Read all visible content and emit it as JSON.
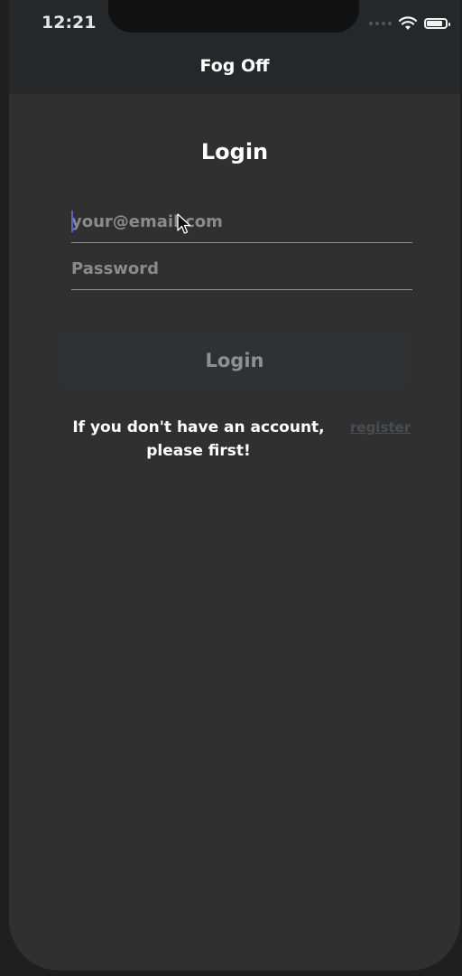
{
  "status_bar": {
    "time": "12:21",
    "battery_level": 0.85
  },
  "header": {
    "title": "Fog Off"
  },
  "form": {
    "heading": "Login",
    "email_placeholder": "your@email.com",
    "email_value": "",
    "password_placeholder": "Password",
    "password_value": "",
    "submit_label": "Login"
  },
  "footer_note": {
    "text": "If you don't have an account, please first!",
    "link_label": "register"
  },
  "colors": {
    "background": "#303030",
    "navbar": "#25282b",
    "caret": "#5a5fd6"
  }
}
